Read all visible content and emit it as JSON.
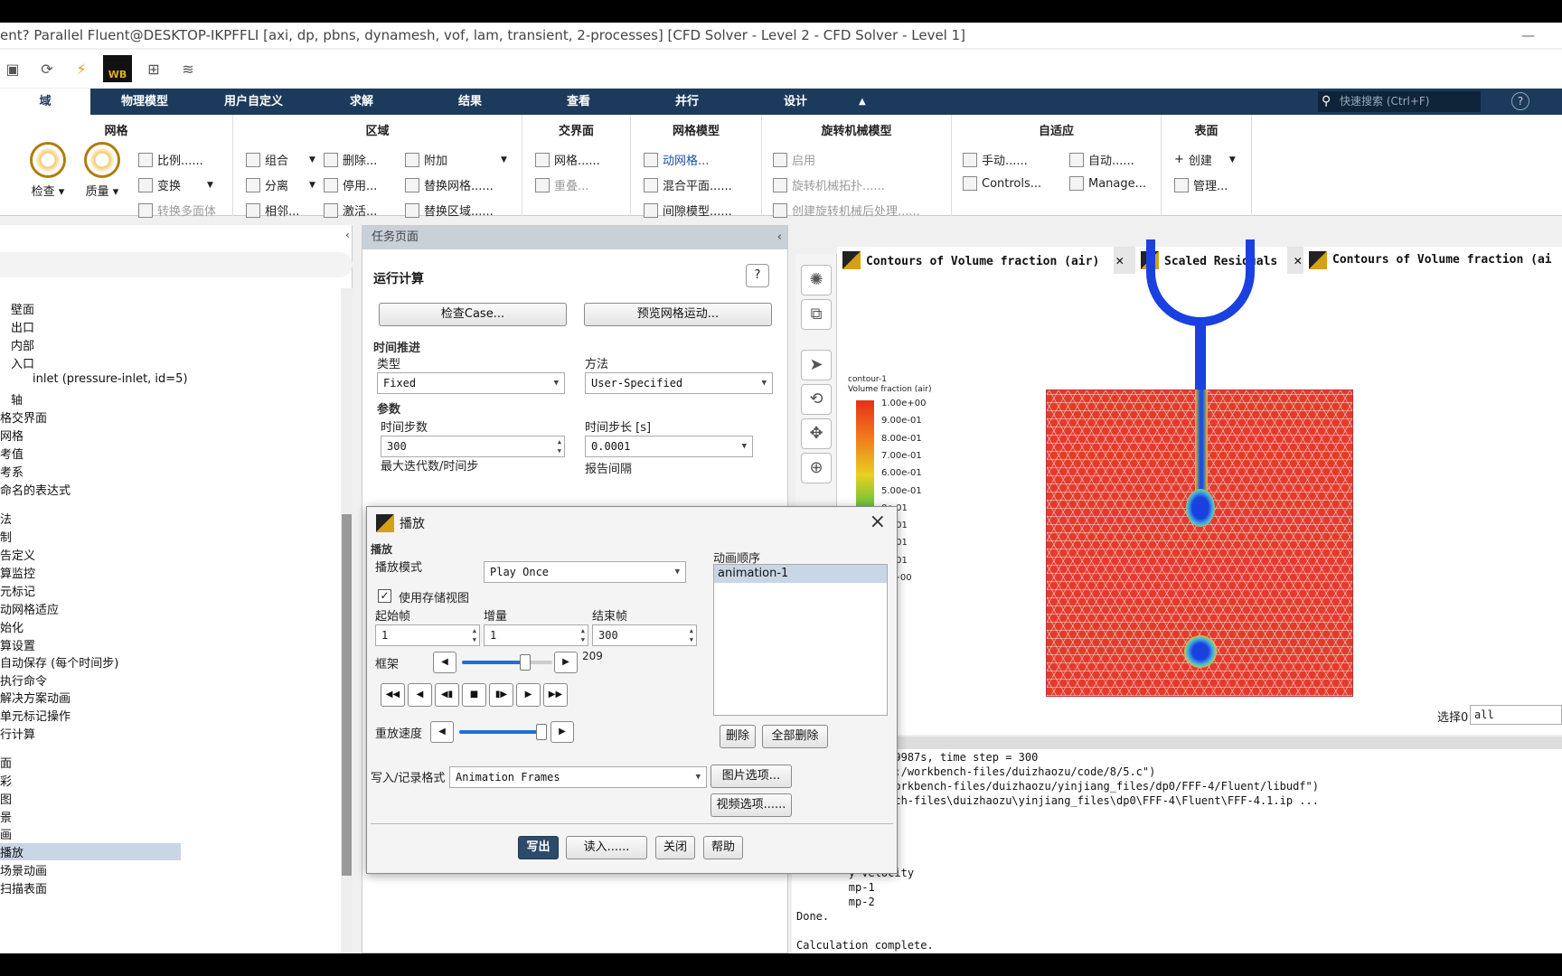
{
  "titlebar": {
    "text": "ent? Parallel Fluent@DESKTOP-IKPFFLI  [axi, dp, pbns, dynamesh, vof, lam, transient, 2-processes] [CFD Solver - Level 2 - CFD Solver - Level 1]",
    "minimize": "—"
  },
  "qat": {
    "wb": "WB"
  },
  "tabs": [
    "域",
    "物理模型",
    "用户自定义",
    "求解",
    "结果",
    "查看",
    "并行",
    "设计"
  ],
  "search": {
    "placeholder": "快速搜索 (Ctrl+F)"
  },
  "ribbon": {
    "mesh": {
      "title": "网格",
      "check": "检查",
      "quality": "质量",
      "scale": "比例......",
      "transform": "变换",
      "convert": "转换多面体"
    },
    "zone": {
      "title": "区域",
      "combine": "组合",
      "separate": "分离",
      "adjacency": "相邻...",
      "delete": "删除...",
      "deactivate": "停用...",
      "activate": "激活...",
      "append": "附加",
      "replace_mesh": "替换网格......",
      "replace_zone": "替换区域......"
    },
    "interface": {
      "title": "交界面",
      "mesh": "网格......",
      "overlap": "重叠..."
    },
    "mesh_models": {
      "title": "网格模型",
      "dynamic": "动网格...",
      "mixing": "混合平面......",
      "gap": "间隙模型......"
    },
    "turbo": {
      "title": "旋转机械模型",
      "enable": "启用",
      "topology": "旋转机械拓扑......",
      "post": "创建旋转机械后处理......"
    },
    "adapt": {
      "title": "自适应",
      "manual": "手动......",
      "auto": "自动......",
      "controls": "Controls...",
      "manage": "Manage..."
    },
    "surface": {
      "title": "表面",
      "create": "创建",
      "manage": "管理..."
    }
  },
  "tree": [
    "壁面",
    "出口",
    "内部",
    "入口",
    "inlet (pressure-inlet, id=5)",
    "轴",
    "格交界面",
    "网格",
    "考值",
    "考系",
    "命名的表达式",
    "法",
    "制",
    "告定义",
    "算监控",
    "元标记",
    "动网格适应",
    "始化",
    "算设置",
    "自动保存 (每个时间步)",
    "执行命令",
    "解决方案动画",
    "单元标记操作",
    "行计算",
    "面",
    "彩",
    "图",
    "景",
    "画",
    "播放",
    "场景动画",
    "扫描表面"
  ],
  "taskpage": {
    "header": "任务页面",
    "title": "运行计算",
    "check_case": "检查Case...",
    "preview_mesh": "预览网格运动...",
    "time_advance": "时间推进",
    "type_label": "类型",
    "type_value": "Fixed",
    "method_label": "方法",
    "method_value": "User-Specified",
    "params": "参数",
    "steps_label": "时间步数",
    "steps_value": "300",
    "dt_label": "时间步长 [s]",
    "dt_value": "0.0001",
    "maxiter_label": "最大迭代数/时间步",
    "report_label": "报告间隔"
  },
  "gfx_tabs": [
    {
      "label": "Contours of Volume fraction (air)",
      "close": "✕"
    },
    {
      "label": "Scaled Residuals",
      "close": "✕"
    },
    {
      "label": "Contours of Volume fraction (ai",
      "close": ""
    }
  ],
  "legend": {
    "title1": "contour-1",
    "title2": "Volume fraction (air)",
    "ticks": [
      "1.00e+00",
      "9.00e-01",
      "8.00e-01",
      "7.00e-01",
      "6.00e-01",
      "5.00e-01",
      "0e-01",
      "0e-01",
      "0e-01",
      "0e-01",
      "0e+00"
    ]
  },
  "select": {
    "label": "选择0",
    "value": "all"
  },
  "console": [
    "   -029999999999987s, time step = 300",
    "   fSource, (\"D:/workbench-files/duizhaozu/code/8/5.c\")",
    "   flib, (\"D:/workbench-files/duizhaozu/yinjiang_files/dp0/FFF-4/Fluent/libudf\")",
    "   o D:\\workbench-files\\duizhaozu\\yinjiang_files\\dp0\\FFF-4\\Fluent\\FFF-4.1.ip ...",
    "",
    "",
    "        e",
    "        ity",
    "        y-velocity",
    "        mp-1",
    "        mp-2",
    "Done.",
    "",
    "Calculation complete."
  ],
  "dialog": {
    "title": "播放",
    "section": "播放",
    "mode_label": "播放模式",
    "mode_value": "Play Once",
    "use_stored": "使用存储视图",
    "start_label": "起始帧",
    "start_value": "1",
    "inc_label": "增量",
    "inc_value": "1",
    "end_label": "结束帧",
    "end_value": "300",
    "frame_label": "框架",
    "frame_value": "209",
    "frame_fraction": 0.697,
    "speed_label": "重放速度",
    "speed_fraction": 0.95,
    "seq_label": "动画顺序",
    "seq_item": "animation-1",
    "delete": "删除",
    "delete_all": "全部删除",
    "write_label": "写入/记录格式",
    "write_value": "Animation Frames",
    "image_opts": "图片选项...",
    "video_opts": "视频选项......",
    "btn_write": "写出",
    "btn_read": "读入......",
    "btn_close": "关闭",
    "btn_help": "帮助"
  }
}
